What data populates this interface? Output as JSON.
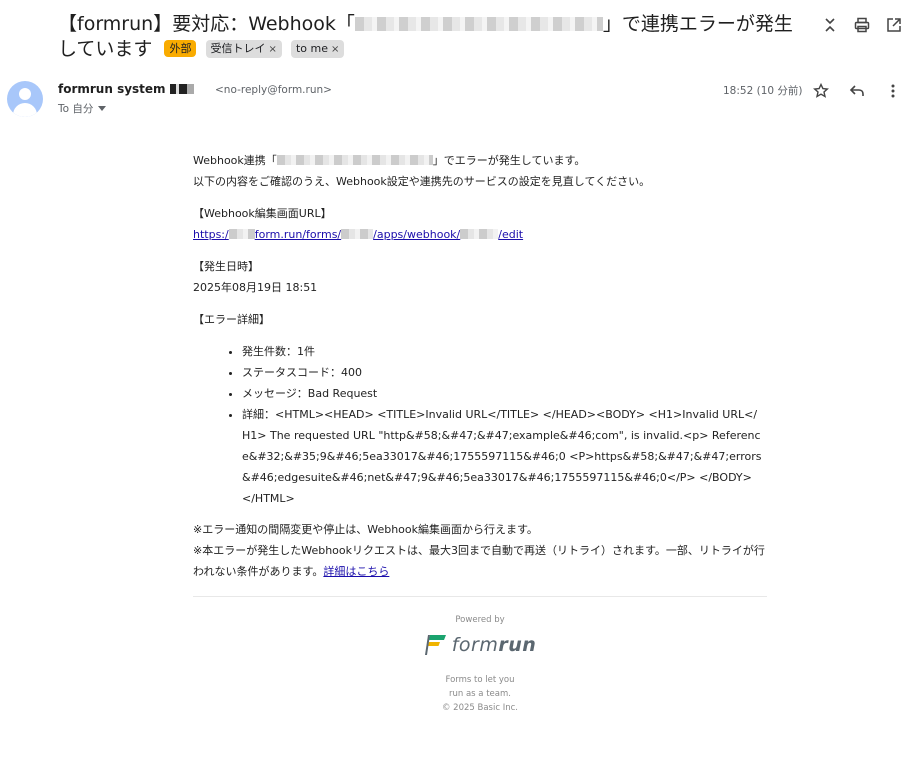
{
  "subject": {
    "prefix": "【formrun】要対応：Webhook「",
    "suffix": "」で連携エラーが発生しています",
    "tags": [
      {
        "label": "外部",
        "removable": false,
        "color": "#f9ab00"
      },
      {
        "label": "受信トレイ",
        "removable": true
      },
      {
        "label": "to me",
        "removable": true
      }
    ]
  },
  "toolbar": {
    "icons": [
      "collapse-icon",
      "print-icon",
      "open-in-new-window-icon"
    ]
  },
  "sender": {
    "name": "formrun system",
    "email": "<no-reply@form.run>",
    "to_label": "To 自分",
    "time": "18:52 (10 分前)"
  },
  "actions": {
    "icons": [
      "star-icon",
      "reply-icon",
      "more-vert-icon"
    ]
  },
  "body": {
    "intro_prefix": "Webhook連携「",
    "intro_suffix": "」でエラーが発生しています。",
    "intro_line2": "以下の内容をご確認のうえ、Webhook設定や連携先のサービスの設定を見直してください。",
    "url_heading": "【Webhook編集画面URL】",
    "url_parts": [
      "https:/",
      "form.run/forms/",
      "/apps/webhook/",
      "/edit"
    ],
    "date_heading": "【発生日時】",
    "date_value": "2025年08月19日 18:51",
    "error_heading": "【エラー詳細】",
    "error_items": [
      "発生件数：1件",
      "ステータスコード：400",
      "メッセージ：Bad Request",
      "詳細：<HTML><HEAD> <TITLE>Invalid URL</TITLE> </HEAD><BODY> <H1>Invalid URL</H1> The requested URL \"http&#58;&#47;&#47;example&#46;com\", is invalid.<p> Reference&#32;&#35;9&#46;5ea33017&#46;1755597115&#46;0 <P>https&#58;&#47;&#47;errors&#46;edgesuite&#46;net&#47;9&#46;5ea33017&#46;1755597115&#46;0</P> </BODY></HTML>"
    ],
    "note1": "※エラー通知の間隔変更や停止は、Webhook編集画面から行えます。",
    "note2": "※本エラーが発生したWebhookリクエストは、最大3回まで自動で再送（リトライ）されます。一部、リトライが行われない条件があります。",
    "note2_link": "詳細はこちら"
  },
  "footer": {
    "powered_by": "Powered by",
    "logo_text_a": "form",
    "logo_text_b": "run",
    "tagline1": "Forms to let you",
    "tagline2": "run as a team.",
    "copyright": "© 2025 Basic Inc."
  }
}
